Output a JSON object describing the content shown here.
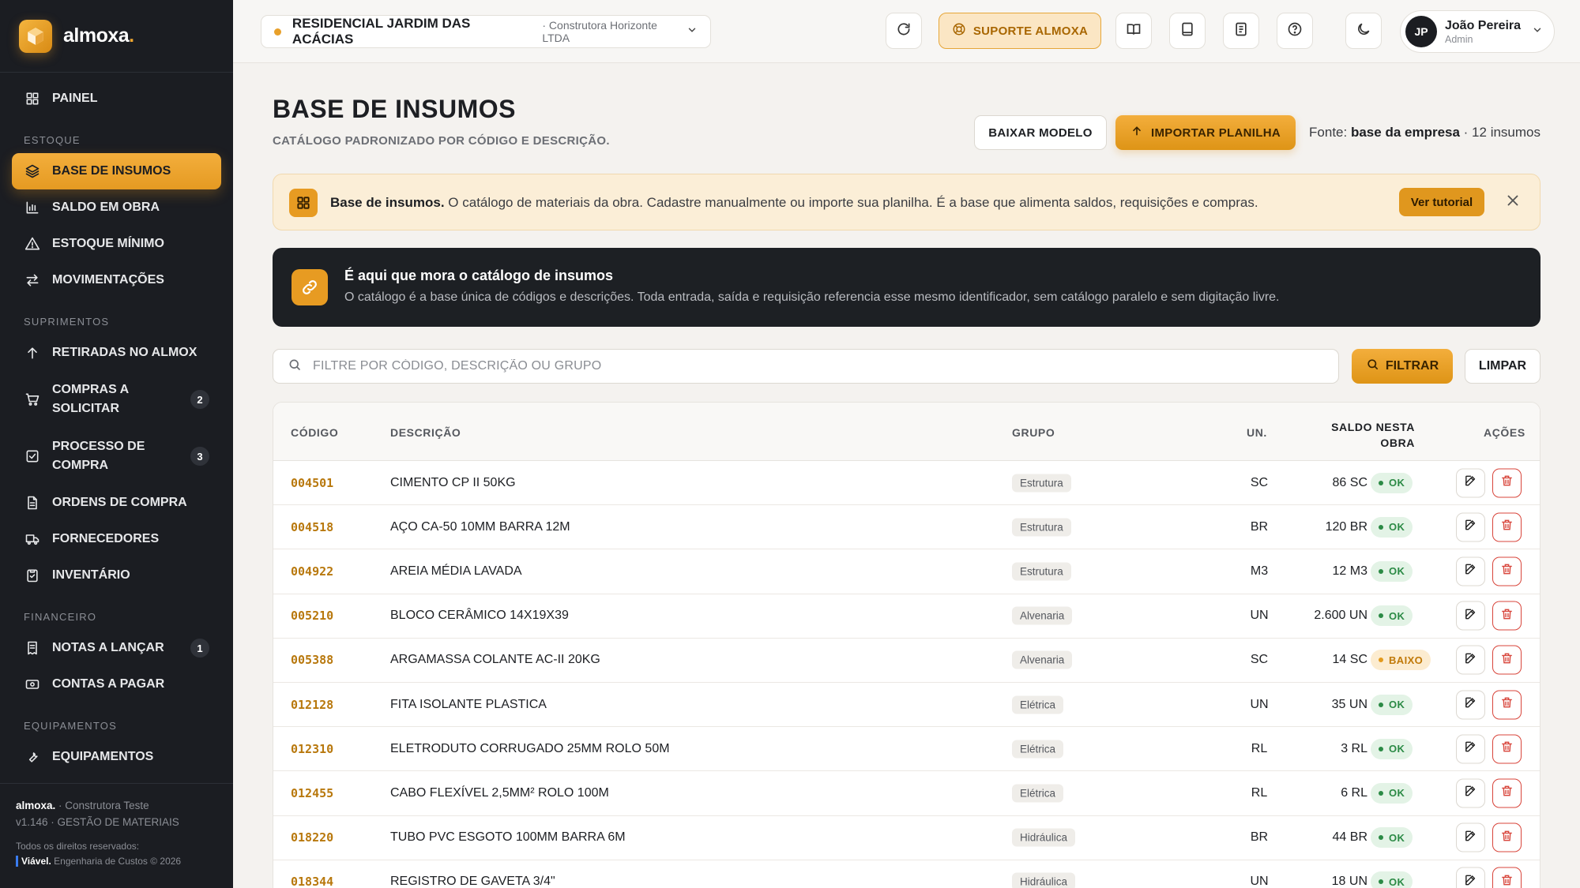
{
  "brand": {
    "name": "almoxa",
    "dot": "."
  },
  "sidebar": {
    "items": [
      {
        "label": "PAINEL",
        "icon": "grid-icon"
      },
      {
        "section": "ESTOQUE"
      },
      {
        "label": "BASE DE INSUMOS",
        "icon": "layers-icon",
        "active": true
      },
      {
        "label": "SALDO EM OBRA",
        "icon": "bar-chart-icon"
      },
      {
        "label": "ESTOQUE MÍNIMO",
        "icon": "warning-icon"
      },
      {
        "label": "MOVIMENTAÇÕES",
        "icon": "swap-icon"
      },
      {
        "section": "SUPRIMENTOS"
      },
      {
        "label": "RETIRADAS NO ALMOX",
        "icon": "arrow-up-icon"
      },
      {
        "label": "COMPRAS A SOLICITAR",
        "icon": "cart-icon",
        "badge": "2"
      },
      {
        "label": "PROCESSO DE COMPRA",
        "icon": "check-square-icon",
        "badge": "3"
      },
      {
        "label": "ORDENS DE COMPRA",
        "icon": "document-icon"
      },
      {
        "label": "FORNECEDORES",
        "icon": "truck-icon"
      },
      {
        "label": "INVENTÁRIO",
        "icon": "clipboard-icon"
      },
      {
        "section": "FINANCEIRO"
      },
      {
        "label": "NOTAS A LANÇAR",
        "icon": "receipt-icon",
        "badge": "1"
      },
      {
        "label": "CONTAS A PAGAR",
        "icon": "cash-icon"
      },
      {
        "section": "EQUIPAMENTOS"
      },
      {
        "label": "EQUIPAMENTOS",
        "icon": "tool-icon"
      }
    ],
    "footer": {
      "brand": "almoxa.",
      "company": "· Construtora Teste",
      "version": "v1.146 · GESTÃO DE MATERIAIS",
      "rights": "Todos os direitos reservados:",
      "viavel": "Viável.",
      "credit": "Engenharia de Custos © 2026"
    }
  },
  "topbar": {
    "project_name": "RESIDENCIAL JARDIM DAS ACÁCIAS",
    "project_company": "· Construtora Horizonte LTDA",
    "support_label": "SUPORTE ALMOXA",
    "user_initials": "JP",
    "user_name": "João Pereira",
    "user_role": "Admin"
  },
  "page": {
    "title": "BASE DE INSUMOS",
    "subtitle": "CATÁLOGO PADRONIZADO POR CÓDIGO E DESCRIÇÃO.",
    "download_label": "BAIXAR MODELO",
    "import_label": "IMPORTAR PLANILHA",
    "fonte_prefix": "Fonte:",
    "fonte_value": "base da empresa",
    "fonte_count": "· 12 insumos"
  },
  "banner": {
    "title": "Base de insumos.",
    "text": "O catálogo de materiais da obra. Cadastre manualmente ou importe sua planilha. É a base que alimenta saldos, requisições e compras.",
    "tutorial_label": "Ver tutorial"
  },
  "info": {
    "title": "É aqui que mora o catálogo de insumos",
    "text": "O catálogo é a base única de códigos e descrições. Toda entrada, saída e requisição referencia esse mesmo identificador, sem catálogo paralelo e sem digitação livre."
  },
  "search": {
    "placeholder": "FILTRE POR CÓDIGO, DESCRIÇÃO OU GRUPO",
    "filter_label": "FILTRAR",
    "clear_label": "LIMPAR"
  },
  "table": {
    "headers": {
      "code": "CÓDIGO",
      "desc": "DESCRIÇÃO",
      "group": "GRUPO",
      "unit": "UN.",
      "saldo_1": "SALDO NESTA",
      "saldo_2": "OBRA",
      "actions": "AÇÕES"
    },
    "rows": [
      {
        "code": "004501",
        "desc": "CIMENTO CP II 50KG",
        "group": "Estrutura",
        "unit": "SC",
        "saldo": "86 SC",
        "status": "OK"
      },
      {
        "code": "004518",
        "desc": "AÇO CA-50 10MM BARRA 12M",
        "group": "Estrutura",
        "unit": "BR",
        "saldo": "120 BR",
        "status": "OK"
      },
      {
        "code": "004922",
        "desc": "AREIA MÉDIA LAVADA",
        "group": "Estrutura",
        "unit": "M3",
        "saldo": "12 M3",
        "status": "OK"
      },
      {
        "code": "005210",
        "desc": "BLOCO CERÂMICO 14X19X39",
        "group": "Alvenaria",
        "unit": "UN",
        "saldo": "2.600 UN",
        "status": "OK"
      },
      {
        "code": "005388",
        "desc": "ARGAMASSA COLANTE AC-II 20KG",
        "group": "Alvenaria",
        "unit": "SC",
        "saldo": "14 SC",
        "status": "BAIXO"
      },
      {
        "code": "012128",
        "desc": "FITA ISOLANTE PLASTICA",
        "group": "Elétrica",
        "unit": "UN",
        "saldo": "35 UN",
        "status": "OK"
      },
      {
        "code": "012310",
        "desc": "ELETRODUTO CORRUGADO 25MM ROLO 50M",
        "group": "Elétrica",
        "unit": "RL",
        "saldo": "3 RL",
        "status": "OK"
      },
      {
        "code": "012455",
        "desc": "CABO FLEXÍVEL 2,5MM² ROLO 100M",
        "group": "Elétrica",
        "unit": "RL",
        "saldo": "6 RL",
        "status": "OK"
      },
      {
        "code": "018220",
        "desc": "TUBO PVC ESGOTO 100MM BARRA 6M",
        "group": "Hidráulica",
        "unit": "BR",
        "saldo": "44 BR",
        "status": "OK"
      },
      {
        "code": "018344",
        "desc": "REGISTRO DE GAVETA 3/4\"",
        "group": "Hidráulica",
        "unit": "UN",
        "saldo": "18 UN",
        "status": "OK"
      }
    ]
  },
  "colors": {
    "accent": "#E59A22",
    "sidebar_bg": "#1B1D22",
    "ok": "#2B8A45",
    "low": "#C07908",
    "danger": "#D8453B"
  }
}
